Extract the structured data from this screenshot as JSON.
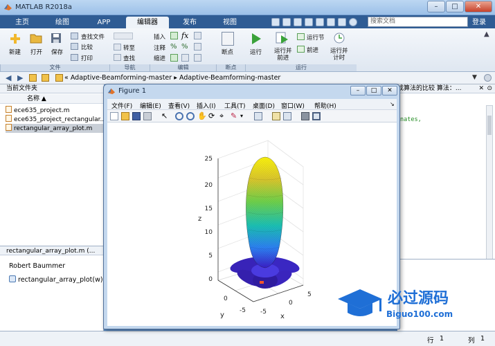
{
  "app": {
    "title": "MATLAB R2018a"
  },
  "window_controls": {
    "minimize": "–",
    "maximize": "□",
    "close": "✕"
  },
  "tabs": [
    "主页",
    "绘图",
    "APP",
    "编辑器",
    "发布",
    "视图"
  ],
  "search": {
    "placeholder": "搜索文档"
  },
  "login_label": "登录",
  "ribbon": {
    "file": {
      "new": "新建",
      "open": "打开",
      "save": "保存",
      "find_files": "查找文件",
      "compare": "比较",
      "print": "打印",
      "group": "文件"
    },
    "navigate": {
      "goto": "转至",
      "find": "查找",
      "group": "导航"
    },
    "edit": {
      "insert": "插入",
      "comment": "注释",
      "indent": "缩进",
      "group": "编辑"
    },
    "breakpoints": {
      "label": "断点",
      "group": "断点"
    },
    "run": {
      "run": "运行",
      "run_advance": "运行并\n前进",
      "run_section": "运行节",
      "advance": "前进",
      "run_time": "运行并\n计时",
      "group": "运行"
    }
  },
  "address": {
    "path": "« Adaptive-Beamforming-master ▸ Adaptive-Beamforming-master"
  },
  "current_folder": {
    "title": "当前文件夹",
    "column": "名称 ▲",
    "files": [
      {
        "name": "ece635_project.m",
        "selected": false
      },
      {
        "name": "ece635_project_rectangular...",
        "selected": false
      },
      {
        "name": "rectangular_array_plot.m",
        "selected": true
      }
    ]
  },
  "details": {
    "title": "rectangular_array_plot.m  (...",
    "author": "Robert Baummer",
    "function": "rectangular_array_plot(w)"
  },
  "editor_bg": {
    "title": "成算法的比较 算法：...",
    "code_fragment": "nates,"
  },
  "statusbar": {
    "row_label": "行",
    "row": "1",
    "col_label": "列",
    "col": "1"
  },
  "figure": {
    "title": "Figure 1",
    "menu": [
      "文件(F)",
      "编辑(E)",
      "查看(V)",
      "插入(I)",
      "工具(T)",
      "桌面(D)",
      "窗口(W)",
      "帮助(H)"
    ],
    "axes": {
      "zticks": [
        "0",
        "5",
        "10",
        "15",
        "20",
        "25"
      ],
      "xticks": [
        "-5",
        "0",
        "5"
      ],
      "yticks": [
        "0",
        "-5"
      ],
      "xlabel": "x",
      "ylabel": "y",
      "zlabel": "z"
    }
  },
  "watermark": {
    "brand": "必过源码",
    "url": "Biguo100.com"
  }
}
